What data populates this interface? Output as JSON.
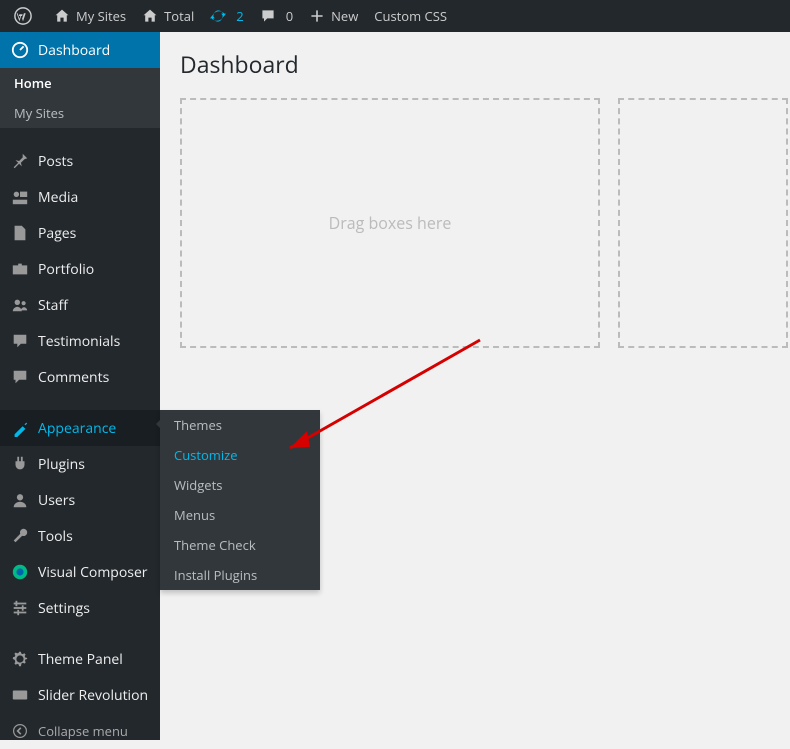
{
  "adminbar": {
    "mysites": "My Sites",
    "site_name": "Total",
    "updates_count": "2",
    "comments_count": "0",
    "new": "New",
    "custom_css": "Custom CSS"
  },
  "sidebar": {
    "dashboard": "Dashboard",
    "dashboard_sub": {
      "home": "Home",
      "mysites": "My Sites"
    },
    "posts": "Posts",
    "media": "Media",
    "pages": "Pages",
    "portfolio": "Portfolio",
    "staff": "Staff",
    "testimonials": "Testimonials",
    "comments": "Comments",
    "appearance": "Appearance",
    "appearance_sub": {
      "themes": "Themes",
      "customize": "Customize",
      "widgets": "Widgets",
      "menus": "Menus",
      "theme_check": "Theme Check",
      "install_plugins": "Install Plugins"
    },
    "plugins": "Plugins",
    "users": "Users",
    "tools": "Tools",
    "visual_composer": "Visual Composer",
    "settings": "Settings",
    "theme_panel": "Theme Panel",
    "slider_revolution": "Slider Revolution",
    "collapse": "Collapse menu"
  },
  "page": {
    "title": "Dashboard",
    "dropzone": "Drag boxes here"
  }
}
